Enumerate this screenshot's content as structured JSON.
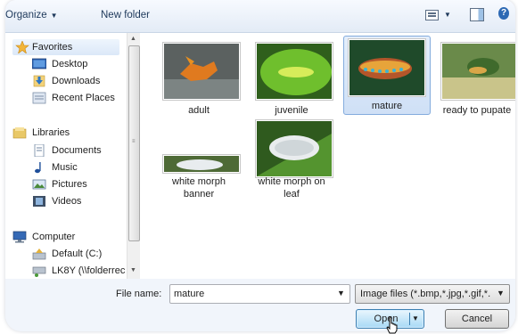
{
  "toolbar": {
    "organize_label": "Organize",
    "new_folder_label": "New folder",
    "views_icon": "views-icon",
    "preview_pane_icon": "preview-pane-icon",
    "help_icon": "help-icon"
  },
  "navigation": {
    "items": [
      {
        "label": "Favorites",
        "icon": "star-icon"
      },
      {
        "label": "Desktop",
        "icon": "desktop-icon"
      },
      {
        "label": "Downloads",
        "icon": "downloads-icon"
      },
      {
        "label": "Recent Places",
        "icon": "recent-places-icon"
      },
      {
        "label": "Libraries",
        "icon": "libraries-icon"
      },
      {
        "label": "Documents",
        "icon": "documents-icon"
      },
      {
        "label": "Music",
        "icon": "music-icon"
      },
      {
        "label": "Pictures",
        "icon": "pictures-icon"
      },
      {
        "label": "Videos",
        "icon": "videos-icon"
      },
      {
        "label": "Computer",
        "icon": "computer-icon"
      },
      {
        "label": "Default (C:)",
        "icon": "drive-icon"
      },
      {
        "label": "LK8Y (\\\\folderrec",
        "icon": "network-drive-icon"
      }
    ]
  },
  "files": [
    {
      "name": "adult",
      "selected": false
    },
    {
      "name": "juvenile",
      "selected": false
    },
    {
      "name": "mature",
      "selected": true
    },
    {
      "name": "ready to pupate",
      "selected": false
    },
    {
      "name": "white morph banner",
      "name_line1": "white morph",
      "name_line2": "banner",
      "selected": false
    },
    {
      "name": "white morph on leaf",
      "name_line1": "white morph on",
      "name_line2": "leaf",
      "selected": false
    }
  ],
  "bottom": {
    "file_name_label": "File name:",
    "file_name_value": "mature",
    "file_type_value": "Image files (*.bmp,*.jpg,*.gif,*.",
    "open_label": "Open",
    "cancel_label": "Cancel"
  },
  "colors": {
    "selection_border": "#84acdd",
    "toolbar_text": "#1e395b",
    "open_button_border": "#3c7fb1"
  }
}
